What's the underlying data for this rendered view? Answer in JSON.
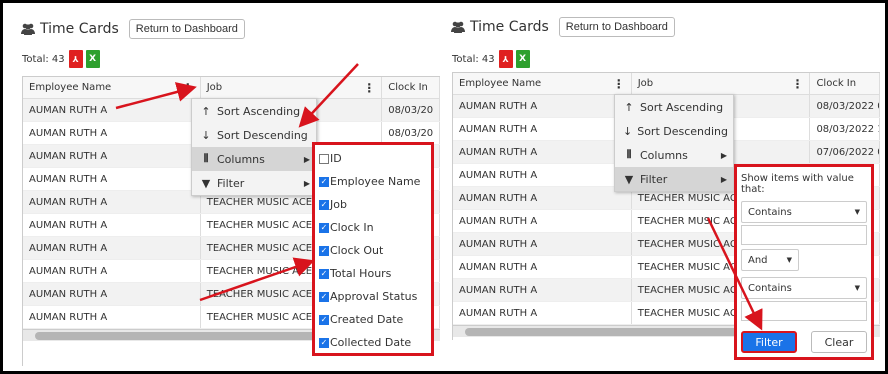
{
  "colors": {
    "accent_red": "#d8141d",
    "primary_blue": "#1a73e8",
    "pdf_red": "#e02020",
    "excel_green": "#2ea02e"
  },
  "left": {
    "title": "Time Cards",
    "return_btn": "Return to Dashboard",
    "total": "Total: 43",
    "headers": [
      "Employee Name",
      "Job",
      "Clock In"
    ],
    "rows": [
      [
        "AUMAN RUTH A",
        "",
        "08/03/20"
      ],
      [
        "AUMAN RUTH A",
        "",
        "08/03/20"
      ],
      [
        "AUMAN RUTH A",
        "",
        ""
      ],
      [
        "AUMAN RUTH A",
        "",
        ""
      ],
      [
        "AUMAN RUTH A",
        "TEACHER MUSIC ACES",
        ""
      ],
      [
        "AUMAN RUTH A",
        "TEACHER MUSIC ACES",
        ""
      ],
      [
        "AUMAN RUTH A",
        "TEACHER MUSIC ACES",
        ""
      ],
      [
        "AUMAN RUTH A",
        "TEACHER MUSIC ACES",
        ""
      ],
      [
        "AUMAN RUTH A",
        "TEACHER MUSIC ACES",
        ""
      ],
      [
        "AUMAN RUTH A",
        "TEACHER MUSIC ACES",
        ""
      ]
    ],
    "menu": [
      "Sort Ascending",
      "Sort Descending",
      "Columns",
      "Filter"
    ],
    "columns": [
      {
        "label": "ID",
        "checked": false
      },
      {
        "label": "Employee Name",
        "checked": true
      },
      {
        "label": "Job",
        "checked": true
      },
      {
        "label": "Clock In",
        "checked": true
      },
      {
        "label": "Clock Out",
        "checked": true
      },
      {
        "label": "Total Hours",
        "checked": true
      },
      {
        "label": "Approval Status",
        "checked": true
      },
      {
        "label": "Created Date",
        "checked": true
      },
      {
        "label": "Collected Date",
        "checked": true
      }
    ]
  },
  "right": {
    "title": "Time Cards",
    "return_btn": "Return to Dashboard",
    "total": "Total: 43",
    "headers": [
      "Employee Name",
      "Job",
      "Clock In"
    ],
    "rows": [
      [
        "AUMAN RUTH A",
        "",
        "08/03/2022 02"
      ],
      [
        "AUMAN RUTH A",
        "",
        "08/03/2022 12"
      ],
      [
        "AUMAN RUTH A",
        "",
        "07/06/2022 03"
      ],
      [
        "AUMAN RUTH A",
        "",
        ""
      ],
      [
        "AUMAN RUTH A",
        "TEACHER MUSIC ACES",
        ""
      ],
      [
        "AUMAN RUTH A",
        "TEACHER MUSIC ACES",
        ""
      ],
      [
        "AUMAN RUTH A",
        "TEACHER MUSIC ACES",
        ""
      ],
      [
        "AUMAN RUTH A",
        "TEACHER MUSIC ACES",
        ""
      ],
      [
        "AUMAN RUTH A",
        "TEACHER MUSIC ACES",
        ""
      ],
      [
        "AUMAN RUTH A",
        "TEACHER MUSIC ACES",
        ""
      ]
    ],
    "menu": [
      "Sort Ascending",
      "Sort Descending",
      "Columns",
      "Filter"
    ],
    "filter": {
      "heading": "Show items with value that:",
      "op1": "Contains",
      "logic": "And",
      "op2": "Contains",
      "filter_btn": "Filter",
      "clear_btn": "Clear"
    }
  }
}
